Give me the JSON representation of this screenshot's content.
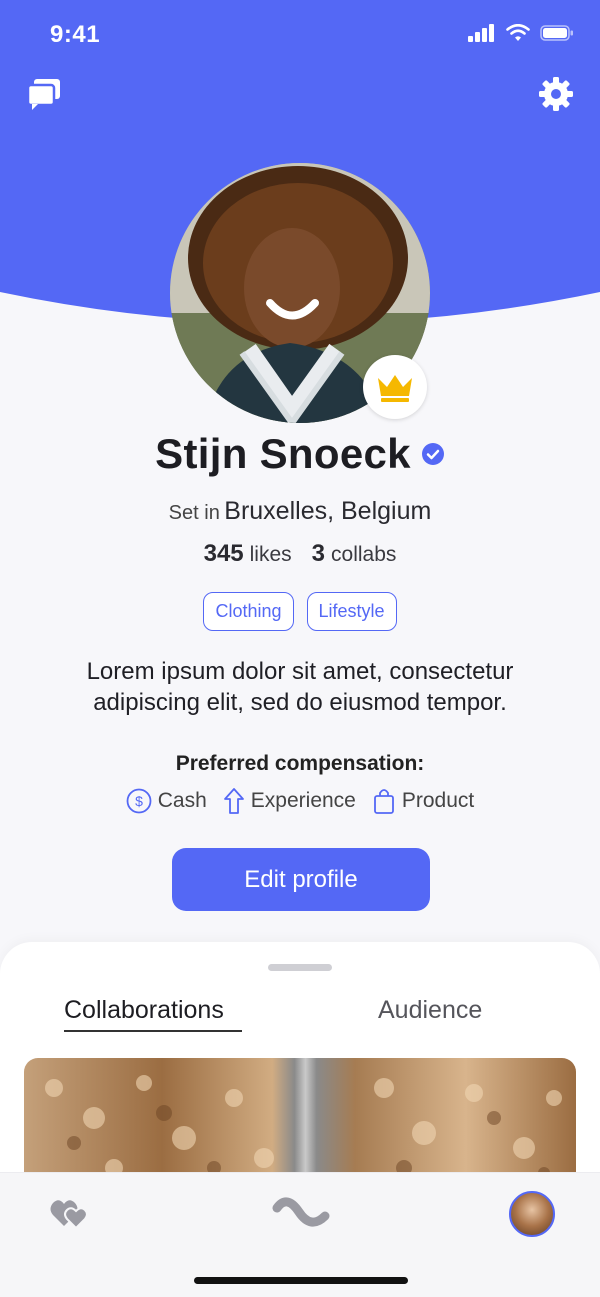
{
  "status_bar": {
    "time": "9:41"
  },
  "profile": {
    "name": "Stijn Snoeck",
    "location_prefix": "Set in",
    "location": "Bruxelles, Belgium",
    "likes_count": "345",
    "likes_label": "likes",
    "collabs_count": "3",
    "collabs_label": "collabs",
    "tags": [
      "Clothing",
      "Lifestyle"
    ],
    "bio": "Lorem ipsum dolor sit amet, consectetur adipiscing elit, sed do eiusmod tempor.",
    "compensation_title": "Preferred compensation:",
    "compensation": [
      {
        "label": "Cash",
        "icon": "dollar-circle-icon"
      },
      {
        "label": "Experience",
        "icon": "arrow-up-icon"
      },
      {
        "label": "Product",
        "icon": "shopping-bag-icon"
      }
    ],
    "edit_button": "Edit profile"
  },
  "tabs": {
    "collaborations": "Collaborations",
    "audience": "Audience",
    "active": "Collaborations"
  },
  "colors": {
    "accent": "#5468f5",
    "crown": "#f5b800",
    "background": "#f7f7fa"
  },
  "icons": {
    "top_left": "chat-bubbles-icon",
    "top_right": "gear-icon",
    "badge": "crown-icon",
    "verified": "verified-check-icon",
    "nav": [
      "hearts-icon",
      "wave-icon",
      "profile-avatar"
    ]
  }
}
